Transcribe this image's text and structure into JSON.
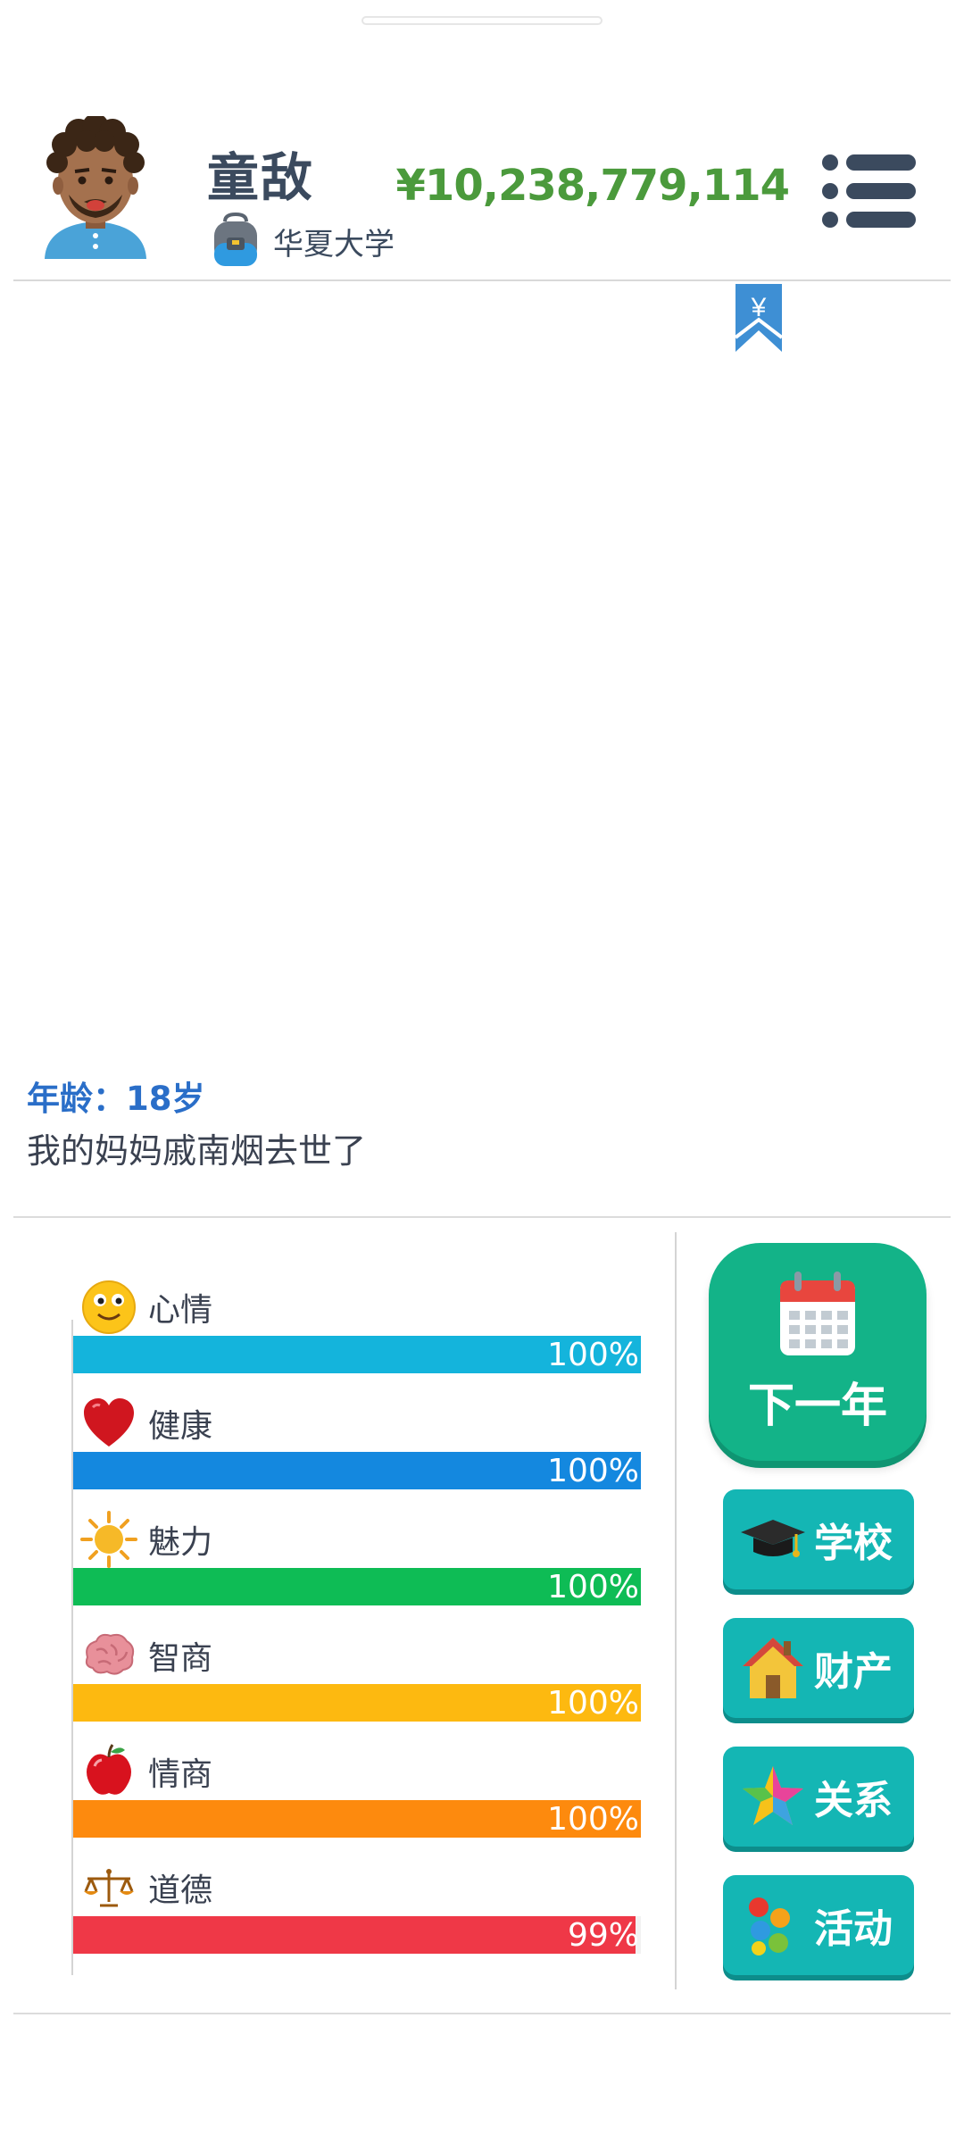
{
  "header": {
    "name": "童敌",
    "school": "华夏大学",
    "money": "¥10,238,779,114",
    "bookmark_symbol": "¥"
  },
  "log": {
    "age_label": "年龄：",
    "age_value": "18岁",
    "event": "我的妈妈戚南烟去世了"
  },
  "stats": [
    {
      "label": "心情",
      "percent_text": "100%",
      "value": 1.0,
      "color": "#14b4dc",
      "icon": "smiley-icon"
    },
    {
      "label": "健康",
      "percent_text": "100%",
      "value": 1.0,
      "color": "#1488df",
      "icon": "heart-icon"
    },
    {
      "label": "魅力",
      "percent_text": "100%",
      "value": 1.0,
      "color": "#0ebc55",
      "icon": "sun-icon"
    },
    {
      "label": "智商",
      "percent_text": "100%",
      "value": 1.0,
      "color": "#fdb910",
      "icon": "brain-icon"
    },
    {
      "label": "情商",
      "percent_text": "100%",
      "value": 1.0,
      "color": "#fd8a0e",
      "icon": "apple-icon"
    },
    {
      "label": "道德",
      "percent_text": "99%",
      "value": 0.99,
      "color": "#ef3847",
      "icon": "scales-icon"
    }
  ],
  "buttons": {
    "next_year": "下一年",
    "school": "学校",
    "property": "财产",
    "relations": "关系",
    "activities": "活动"
  },
  "colors": {
    "money": "#4b9a3c",
    "age": "#2a6ec8",
    "next_year_bg": "#13b388",
    "action_bg": "#14b6b4"
  }
}
